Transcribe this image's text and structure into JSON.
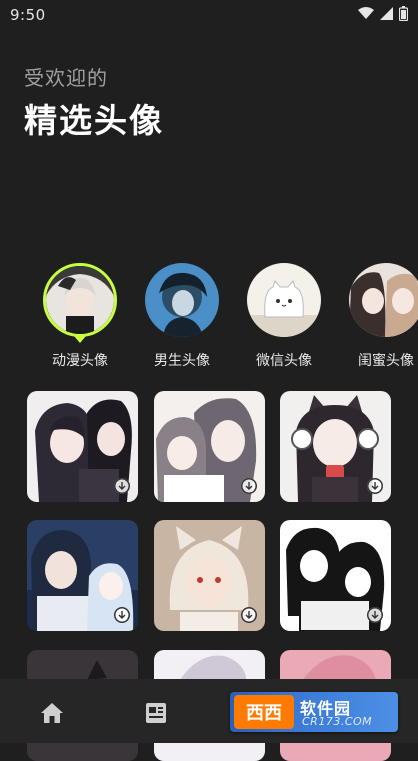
{
  "status_bar": {
    "time": "9:50"
  },
  "header": {
    "subtitle": "受欢迎的",
    "title": "精选头像"
  },
  "categories": [
    {
      "label": "动漫头像",
      "active": true
    },
    {
      "label": "男生头像",
      "active": false
    },
    {
      "label": "微信头像",
      "active": false
    },
    {
      "label": "闺蜜头像",
      "active": false
    }
  ],
  "watermark": {
    "badge": "西西",
    "name": "软件园",
    "domain": "CR173.COM"
  },
  "colors": {
    "accent": "#c6ff3d",
    "background": "#1f1f1f",
    "nav": "#262626"
  },
  "nav_icons": [
    "home-icon",
    "document-icon",
    "profile-icon"
  ]
}
